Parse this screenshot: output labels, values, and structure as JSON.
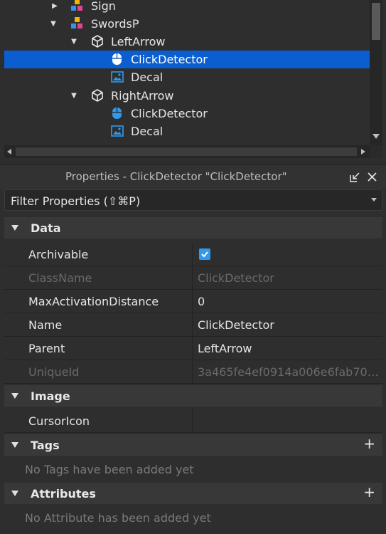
{
  "explorer": {
    "items": [
      {
        "label": "Sign",
        "icon": "model-icon",
        "expanded": false
      },
      {
        "label": "SwordsP",
        "icon": "model-icon",
        "expanded": true
      },
      {
        "label": "LeftArrow",
        "icon": "part-icon",
        "expanded": true
      },
      {
        "label": "ClickDetector",
        "icon": "click-detector-icon",
        "selected": true
      },
      {
        "label": "Decal",
        "icon": "decal-icon"
      },
      {
        "label": "RightArrow",
        "icon": "part-icon",
        "expanded": true
      },
      {
        "label": "ClickDetector",
        "icon": "click-detector-icon"
      },
      {
        "label": "Decal",
        "icon": "decal-icon"
      }
    ]
  },
  "properties": {
    "title": "Properties - ClickDetector \"ClickDetector\"",
    "filter_placeholder": "Filter Properties (⇧⌘P)",
    "sections": {
      "data": {
        "label": "Data",
        "rows": [
          {
            "name": "Archivable",
            "value": "",
            "checked": true
          },
          {
            "name": "ClassName",
            "value": "ClickDetector",
            "disabled": true
          },
          {
            "name": "MaxActivationDistance",
            "value": "0"
          },
          {
            "name": "Name",
            "value": "ClickDetector"
          },
          {
            "name": "Parent",
            "value": "LeftArrow"
          },
          {
            "name": "UniqueId",
            "value": "3a465fe4ef0914a006e6fab7000…",
            "disabled": true
          }
        ]
      },
      "image": {
        "label": "Image",
        "rows": [
          {
            "name": "CursorIcon",
            "value": ""
          }
        ]
      },
      "tags": {
        "label": "Tags",
        "empty_text": "No Tags have been added yet"
      },
      "attributes": {
        "label": "Attributes",
        "empty_text": "No Attribute has been added yet"
      }
    }
  },
  "colors": {
    "selection": "#0b5ed0",
    "accent": "#2f9bf0",
    "background": "#2e2e2e",
    "section": "#383838"
  }
}
